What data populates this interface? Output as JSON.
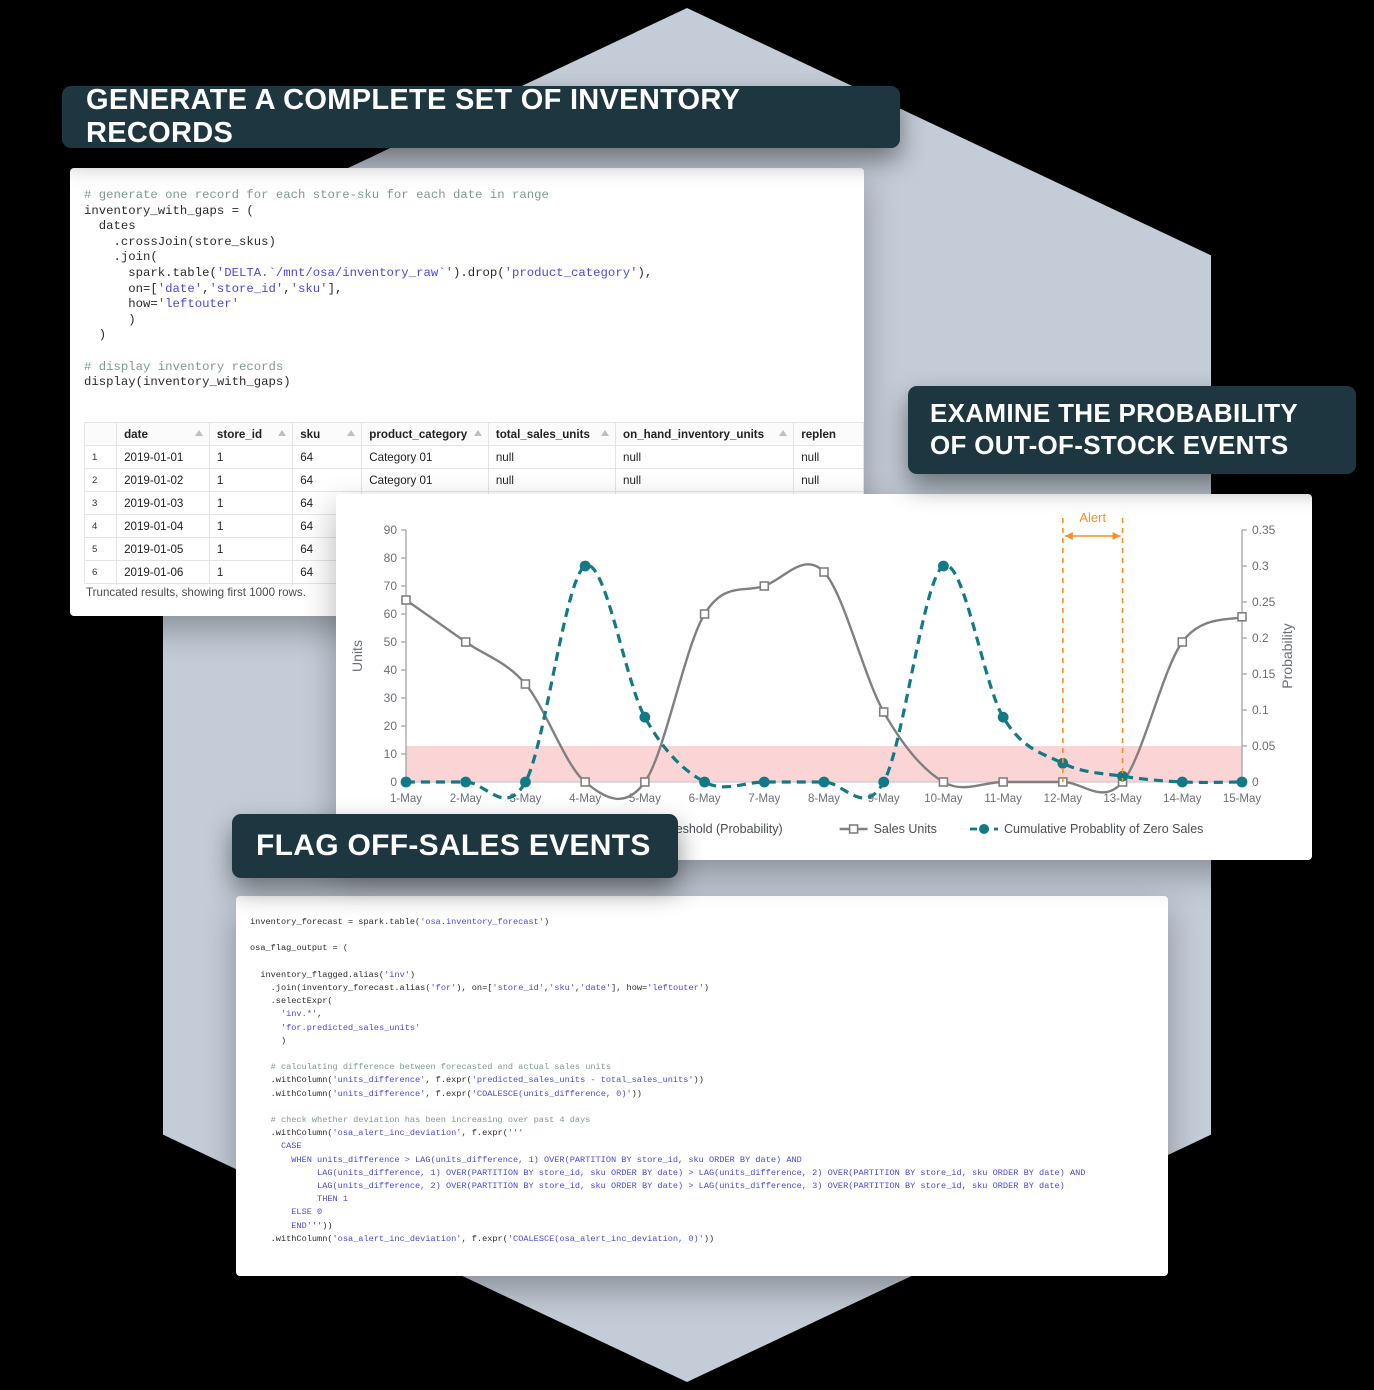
{
  "badges": {
    "generate": "GENERATE A COMPLETE SET OF INVENTORY RECORDS",
    "examine_line1": "EXAMINE THE PROBABILITY",
    "examine_line2": "OF OUT-OF-STOCK EVENTS",
    "flag": "FLAG OFF-SALES EVENTS"
  },
  "notebook_top": {
    "code_lines": [
      {
        "t": "comment",
        "text": "# generate one record for each store-sku for each date in range"
      },
      {
        "t": "plain",
        "text": "inventory_with_gaps = ("
      },
      {
        "t": "plain",
        "text": "  dates"
      },
      {
        "t": "plain",
        "text": "    .crossJoin(store_skus)"
      },
      {
        "t": "plain",
        "text": "    .join("
      },
      {
        "t": "mix",
        "segs": [
          {
            "c": "p",
            "s": "      spark.table("
          },
          {
            "c": "s",
            "s": "'DELTA.`/mnt/osa/inventory_raw`'"
          },
          {
            "c": "p",
            "s": ").drop("
          },
          {
            "c": "s",
            "s": "'product_category'"
          },
          {
            "c": "p",
            "s": "),"
          }
        ]
      },
      {
        "t": "mix",
        "segs": [
          {
            "c": "p",
            "s": "      on=["
          },
          {
            "c": "s",
            "s": "'date'"
          },
          {
            "c": "p",
            "s": ","
          },
          {
            "c": "s",
            "s": "'store_id'"
          },
          {
            "c": "p",
            "s": ","
          },
          {
            "c": "s",
            "s": "'sku'"
          },
          {
            "c": "p",
            "s": "],"
          }
        ]
      },
      {
        "t": "mix",
        "segs": [
          {
            "c": "p",
            "s": "      how="
          },
          {
            "c": "s",
            "s": "'leftouter'"
          }
        ]
      },
      {
        "t": "plain",
        "text": "      )"
      },
      {
        "t": "plain",
        "text": "  )"
      },
      {
        "t": "plain",
        "text": ""
      },
      {
        "t": "comment",
        "text": "# display inventory records"
      },
      {
        "t": "plain",
        "text": "display(inventory_with_gaps)"
      }
    ],
    "table": {
      "columns": [
        "date",
        "store_id",
        "sku",
        "product_category",
        "total_sales_units",
        "on_hand_inventory_units",
        "replen"
      ],
      "rows": [
        {
          "n": "1",
          "cells": [
            "2019-01-01",
            "1",
            "64",
            "Category 01",
            "null",
            "null",
            "null"
          ]
        },
        {
          "n": "2",
          "cells": [
            "2019-01-02",
            "1",
            "64",
            "Category 01",
            "null",
            "null",
            "null"
          ]
        },
        {
          "n": "3",
          "cells": [
            "2019-01-03",
            "1",
            "64",
            "",
            "",
            "",
            ""
          ]
        },
        {
          "n": "4",
          "cells": [
            "2019-01-04",
            "1",
            "64",
            "",
            "",
            "",
            ""
          ]
        },
        {
          "n": "5",
          "cells": [
            "2019-01-05",
            "1",
            "64",
            "",
            "",
            "",
            ""
          ]
        },
        {
          "n": "6",
          "cells": [
            "2019-01-06",
            "1",
            "64",
            "",
            "",
            "",
            ""
          ]
        }
      ],
      "truncation_note": "Truncated results, showing first 1000 rows."
    }
  },
  "notebook_bottom": {
    "code_lines": [
      {
        "t": "mix",
        "segs": [
          {
            "c": "p",
            "s": "inventory_forecast = spark.table("
          },
          {
            "c": "s",
            "s": "'osa.inventory_forecast'"
          },
          {
            "c": "p",
            "s": ")"
          }
        ]
      },
      {
        "t": "plain",
        "text": ""
      },
      {
        "t": "plain",
        "text": "osa_flag_output = ("
      },
      {
        "t": "plain",
        "text": ""
      },
      {
        "t": "mix",
        "segs": [
          {
            "c": "p",
            "s": "  inventory_flagged.alias("
          },
          {
            "c": "s",
            "s": "'inv'"
          },
          {
            "c": "p",
            "s": ")"
          }
        ]
      },
      {
        "t": "mix",
        "segs": [
          {
            "c": "p",
            "s": "    .join(inventory_forecast.alias("
          },
          {
            "c": "s",
            "s": "'for'"
          },
          {
            "c": "p",
            "s": "), on=["
          },
          {
            "c": "s",
            "s": "'store_id'"
          },
          {
            "c": "p",
            "s": ","
          },
          {
            "c": "s",
            "s": "'sku'"
          },
          {
            "c": "p",
            "s": ","
          },
          {
            "c": "s",
            "s": "'date'"
          },
          {
            "c": "p",
            "s": "], how="
          },
          {
            "c": "s",
            "s": "'leftouter'"
          },
          {
            "c": "p",
            "s": ")"
          }
        ]
      },
      {
        "t": "plain",
        "text": "    .selectExpr("
      },
      {
        "t": "mix",
        "segs": [
          {
            "c": "p",
            "s": "      "
          },
          {
            "c": "s",
            "s": "'inv.*'"
          },
          {
            "c": "p",
            "s": ","
          }
        ]
      },
      {
        "t": "mix",
        "segs": [
          {
            "c": "p",
            "s": "      "
          },
          {
            "c": "s",
            "s": "'for.predicted_sales_units'"
          }
        ]
      },
      {
        "t": "plain",
        "text": "      )"
      },
      {
        "t": "plain",
        "text": ""
      },
      {
        "t": "comment",
        "text": "    # calculating difference between forecasted and actual sales units"
      },
      {
        "t": "mix",
        "segs": [
          {
            "c": "p",
            "s": "    .withColumn("
          },
          {
            "c": "s",
            "s": "'units_difference'"
          },
          {
            "c": "p",
            "s": ", f.expr("
          },
          {
            "c": "s",
            "s": "'predicted_sales_units - total_sales_units'"
          },
          {
            "c": "p",
            "s": "))"
          }
        ]
      },
      {
        "t": "mix",
        "segs": [
          {
            "c": "p",
            "s": "    .withColumn("
          },
          {
            "c": "s",
            "s": "'units_difference'"
          },
          {
            "c": "p",
            "s": ", f.expr("
          },
          {
            "c": "s",
            "s": "'COALESCE(units_difference, 0)'"
          },
          {
            "c": "p",
            "s": "))"
          }
        ]
      },
      {
        "t": "plain",
        "text": ""
      },
      {
        "t": "comment",
        "text": "    # check whether deviation has been increasing over past 4 days"
      },
      {
        "t": "mix",
        "segs": [
          {
            "c": "p",
            "s": "    .withColumn("
          },
          {
            "c": "s",
            "s": "'osa_alert_inc_deviation'"
          },
          {
            "c": "p",
            "s": ", f.expr("
          },
          {
            "c": "s",
            "s": "'''"
          }
        ]
      },
      {
        "t": "mix",
        "segs": [
          {
            "c": "s",
            "s": "      CASE"
          }
        ]
      },
      {
        "t": "mix",
        "segs": [
          {
            "c": "s",
            "s": "        WHEN units_difference > LAG(units_difference, 1) OVER(PARTITION BY store_id, sku ORDER BY date) AND"
          }
        ]
      },
      {
        "t": "mix",
        "segs": [
          {
            "c": "s",
            "s": "             LAG(units_difference, 1) OVER(PARTITION BY store_id, sku ORDER BY date) > LAG(units_difference, 2) OVER(PARTITION BY store_id, sku ORDER BY date) AND"
          }
        ]
      },
      {
        "t": "mix",
        "segs": [
          {
            "c": "s",
            "s": "             LAG(units_difference, 2) OVER(PARTITION BY store_id, sku ORDER BY date) > LAG(units_difference, 3) OVER(PARTITION BY store_id, sku ORDER BY date)"
          }
        ]
      },
      {
        "t": "mix",
        "segs": [
          {
            "c": "s",
            "s": "             THEN 1"
          }
        ]
      },
      {
        "t": "mix",
        "segs": [
          {
            "c": "s",
            "s": "        ELSE 0"
          }
        ]
      },
      {
        "t": "mix",
        "segs": [
          {
            "c": "s",
            "s": "        END'''"
          },
          {
            "c": "p",
            "s": "))"
          }
        ]
      },
      {
        "t": "mix",
        "segs": [
          {
            "c": "p",
            "s": "    .withColumn("
          },
          {
            "c": "s",
            "s": "'osa_alert_inc_deviation'"
          },
          {
            "c": "p",
            "s": ", f.expr("
          },
          {
            "c": "s",
            "s": "'COALESCE(osa_alert_inc_deviation, 0)'"
          },
          {
            "c": "p",
            "s": "))"
          }
        ]
      }
    ]
  },
  "chart_data": {
    "type": "line",
    "title": "",
    "xlabel": "",
    "ylabel": "Units",
    "y2label": "Probability",
    "categories": [
      "1-May",
      "2-May",
      "3-May",
      "4-May",
      "5-May",
      "6-May",
      "7-May",
      "8-May",
      "9-May",
      "10-May",
      "11-May",
      "12-May",
      "13-May",
      "14-May",
      "15-May"
    ],
    "ylim": [
      0,
      90
    ],
    "yticks": [
      0,
      10,
      20,
      30,
      40,
      50,
      60,
      70,
      80,
      90
    ],
    "y2lim": [
      0,
      0.35
    ],
    "y2ticks": [
      "0",
      "0.05",
      "0.1",
      "0.15",
      "0.2",
      "0.25",
      "0.3",
      "0.35"
    ],
    "grid": false,
    "legend_position": "bottom",
    "series": [
      {
        "name": "Sales Units",
        "axis": "left",
        "color": "#808080",
        "marker": "square",
        "dash": "solid",
        "values": [
          65,
          50,
          35,
          0,
          0,
          60,
          70,
          75,
          25,
          0,
          0,
          0,
          0,
          50,
          59
        ]
      },
      {
        "name": "Cumulative Probablity of Zero Sales",
        "axis": "right",
        "color": "#127a86",
        "marker": "circle",
        "dash": "dashed",
        "values": [
          0,
          0,
          0,
          0.3,
          0.09,
          0,
          0,
          0,
          0,
          0.3,
          0.09,
          0.026,
          0.008,
          0,
          0
        ]
      }
    ],
    "threshold_band": {
      "name": "Alert Threshold (Probability)",
      "color": "#fbd4d6",
      "value": 0.05,
      "from": "1-May",
      "to": "15-May"
    },
    "annotation": {
      "label": "Alert",
      "from": "12-May",
      "to": "13-May",
      "color": "#f5902a"
    },
    "legend": [
      {
        "label": "Alert Threshold (Probability)",
        "type": "band",
        "color": "#fbd4d6"
      },
      {
        "label": "Sales Units",
        "type": "line-square",
        "color": "#808080"
      },
      {
        "label": "Cumulative Probablity of Zero Sales",
        "type": "line-circle-dashed",
        "color": "#127a86"
      }
    ]
  },
  "colors": {
    "badge_bg": "#1e3640",
    "hexagon": "#c4ccd8",
    "accent_teal": "#127a86",
    "accent_orange": "#f5902a",
    "threshold_pink": "#fbd4d6",
    "sales_gray": "#808080"
  }
}
